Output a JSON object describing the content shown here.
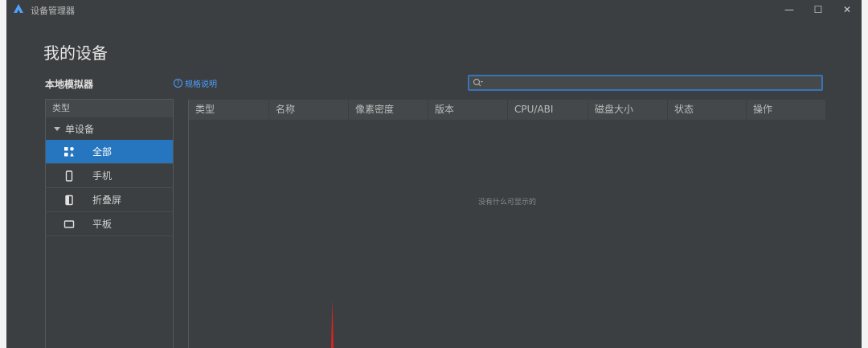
{
  "window": {
    "title": "设备管理器"
  },
  "titlebar": {
    "minimize_label": "—",
    "maximize_label": "☐",
    "close_label": "✕"
  },
  "page": {
    "title": "我的设备"
  },
  "section": {
    "title": "本地模拟器",
    "spec_link": "规格说明"
  },
  "search": {
    "value": "",
    "placeholder": ""
  },
  "sidebar": {
    "header": "类型",
    "group": "单设备",
    "items": [
      {
        "label": "全部",
        "icon": "grid-icon",
        "selected": true
      },
      {
        "label": "手机",
        "icon": "phone-icon",
        "selected": false
      },
      {
        "label": "折叠屏",
        "icon": "foldable-icon",
        "selected": false
      },
      {
        "label": "平板",
        "icon": "tablet-icon",
        "selected": false
      }
    ]
  },
  "table": {
    "columns": [
      "类型",
      "名称",
      "像素密度",
      "版本",
      "CPU/ABI",
      "磁盘大小",
      "状态",
      "操作"
    ],
    "empty_text": "没有什么可显示的"
  },
  "colors": {
    "accent": "#2675bf",
    "link": "#4a9eff",
    "search_border": "#3874b6",
    "annotation": "#e0231b"
  }
}
